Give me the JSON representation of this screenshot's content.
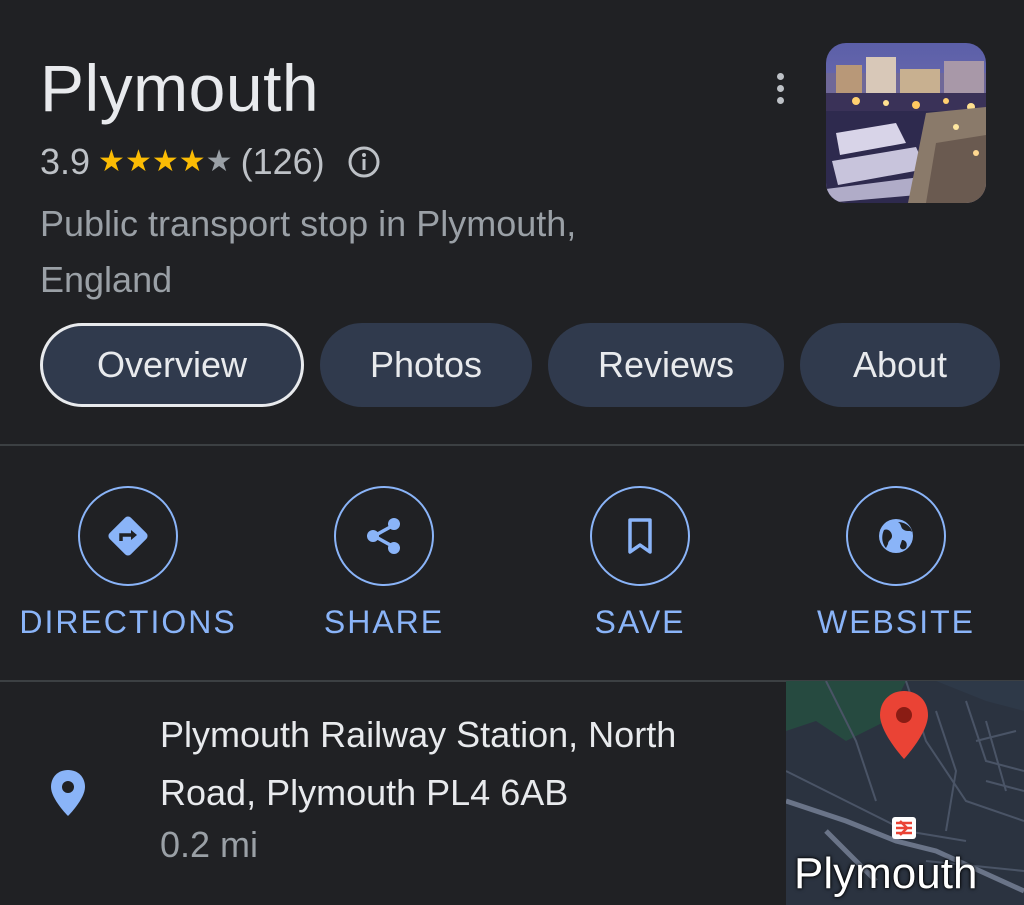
{
  "place": {
    "title": "Plymouth",
    "rating": "3.9",
    "rating_value": 3.9,
    "stars_max": 5,
    "review_count": "(126)",
    "category_line1": "Public transport stop in Plymouth,",
    "category_line2": "England",
    "thumbnail_icon": "harbour-night-photo"
  },
  "tabs": [
    {
      "label": "Overview",
      "active": true
    },
    {
      "label": "Photos",
      "active": false
    },
    {
      "label": "Reviews",
      "active": false
    },
    {
      "label": "About",
      "active": false
    }
  ],
  "actions": [
    {
      "label": "DIRECTIONS",
      "icon": "directions-icon"
    },
    {
      "label": "SHARE",
      "icon": "share-icon"
    },
    {
      "label": "SAVE",
      "icon": "bookmark-icon"
    },
    {
      "label": "WEBSITE",
      "icon": "globe-icon"
    }
  ],
  "address": {
    "line1": "Plymouth Railway Station, North",
    "line2": "Road, Plymouth PL4 6AB",
    "distance": "0.2 mi",
    "map_label": "Plymouth"
  },
  "colors": {
    "background": "#202124",
    "accent": "#8ab4f8",
    "star": "#fbbc04",
    "tab_bg": "#303a4d",
    "pin_red": "#ea4335"
  }
}
